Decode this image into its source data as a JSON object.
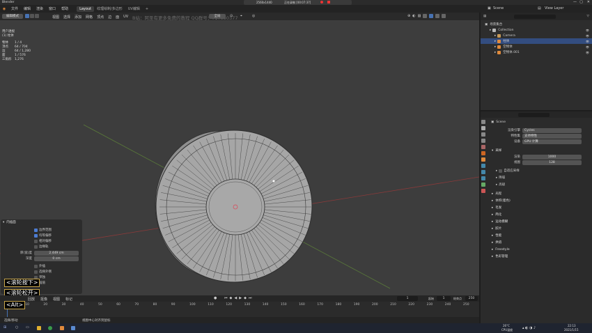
{
  "window": {
    "app_title": "Blender",
    "resolution": "2560x1440",
    "recording_label": "正在录制 [00:07:37]"
  },
  "menu": [
    "文件",
    "编辑",
    "渲染",
    "窗口",
    "帮助"
  ],
  "workspaces": [
    "Layout",
    "纹理绘制/多边形",
    "UV编辑"
  ],
  "workspace_active": 0,
  "scene": {
    "scene_label": "Scene",
    "view_layer": "View Layer"
  },
  "viewport_header": {
    "mode": "编辑模式",
    "menus": [
      "视图",
      "选择",
      "添加",
      "网格",
      "顶点",
      "边",
      "面",
      "UV"
    ],
    "transform_orientation": "全局",
    "watermark": "B站：阿圣有更多免费的教程      QQ群号：717530377"
  },
  "viewport_info": {
    "view_name": "用户透视",
    "object_name": "(1) 柱体",
    "stats": [
      {
        "label": "物体",
        "value": "1 / 4"
      },
      {
        "label": "顶点",
        "value": "64 / 704"
      },
      {
        "label": "边",
        "value": "64 / 1,280"
      },
      {
        "label": "面",
        "value": "1 / 576"
      },
      {
        "label": "三角形",
        "value": "1,276"
      }
    ]
  },
  "operator_panel": {
    "title": "内插面",
    "options": [
      {
        "label": "边界范围",
        "checked": true
      },
      {
        "label": "均等偏移",
        "checked": true
      },
      {
        "label": "相对偏移",
        "checked": false
      },
      {
        "label": "边缘轨",
        "checked": false
      }
    ],
    "thickness_label": "厚(宽)度",
    "thickness_value": "2.449 cm",
    "depth_label": "深度",
    "depth_value": "0 cm",
    "options2": [
      {
        "label": "外插",
        "checked": false
      },
      {
        "label": "选择外侧",
        "checked": false
      },
      {
        "label": "单独",
        "checked": false
      },
      {
        "label": "插值",
        "checked": true
      }
    ]
  },
  "key_overlays": [
    "<滚轮按下>",
    "<滚轮松开>",
    "<Alt>"
  ],
  "timeline": {
    "menus": [
      "回放",
      "抠像",
      "视图",
      "标记"
    ],
    "current_frame": "1",
    "start_label": "起始",
    "start": "1",
    "end_label": "结束点",
    "end": "250",
    "ticks": [
      "0",
      "10",
      "20",
      "30",
      "40",
      "50",
      "60",
      "70",
      "80",
      "90",
      "100",
      "110",
      "120",
      "130",
      "140",
      "150",
      "160",
      "170",
      "180",
      "190",
      "200",
      "210",
      "220",
      "230",
      "240",
      "250"
    ]
  },
  "statusbar": {
    "left": "选择/移动",
    "middle": "视图中心对齐到鼠标",
    "version": "2.90.0"
  },
  "outliner": {
    "title": "场景集合",
    "items": [
      {
        "label": "Collection",
        "depth": 1,
        "color": "#bbbbbb",
        "selected": false
      },
      {
        "label": "Camera",
        "depth": 2,
        "color": "#c89a58",
        "selected": false
      },
      {
        "label": "柱体",
        "depth": 2,
        "color": "#e08a3c",
        "selected": true
      },
      {
        "label": "空物体",
        "depth": 2,
        "color": "#e08a3c",
        "selected": false
      },
      {
        "label": "空物体.001",
        "depth": 2,
        "color": "#e08a3c",
        "selected": false
      }
    ]
  },
  "properties": {
    "scene_name": "Scene",
    "render_engine_label": "渲染引擎",
    "render_engine": "Cycles",
    "feature_set_label": "特性集",
    "feature_set": "支持特性",
    "device_label": "设备",
    "device": "GPU 计算",
    "sampling_title": "采样",
    "render_label": "渲染",
    "render_samples": "1000",
    "viewport_label": "视图",
    "viewport_samples": "128",
    "sub_sections": [
      "自适应采样",
      "降噪",
      "高级"
    ],
    "sections": [
      "光程",
      "体积(着色)",
      "毛发",
      "简化",
      "运动模糊",
      "胶片",
      "性能",
      "烘焙",
      "Freestyle",
      "色彩管理"
    ]
  },
  "taskbar": {
    "temp": "26°C",
    "cpu_label": "CPU温度",
    "time": "22:13",
    "date": "2021/1/15"
  },
  "colors": {
    "selected_row": "#334d80",
    "accent": "#4772b3",
    "mesh_face": "#a6a6a6",
    "mesh_edge": "#2d2d2d"
  }
}
